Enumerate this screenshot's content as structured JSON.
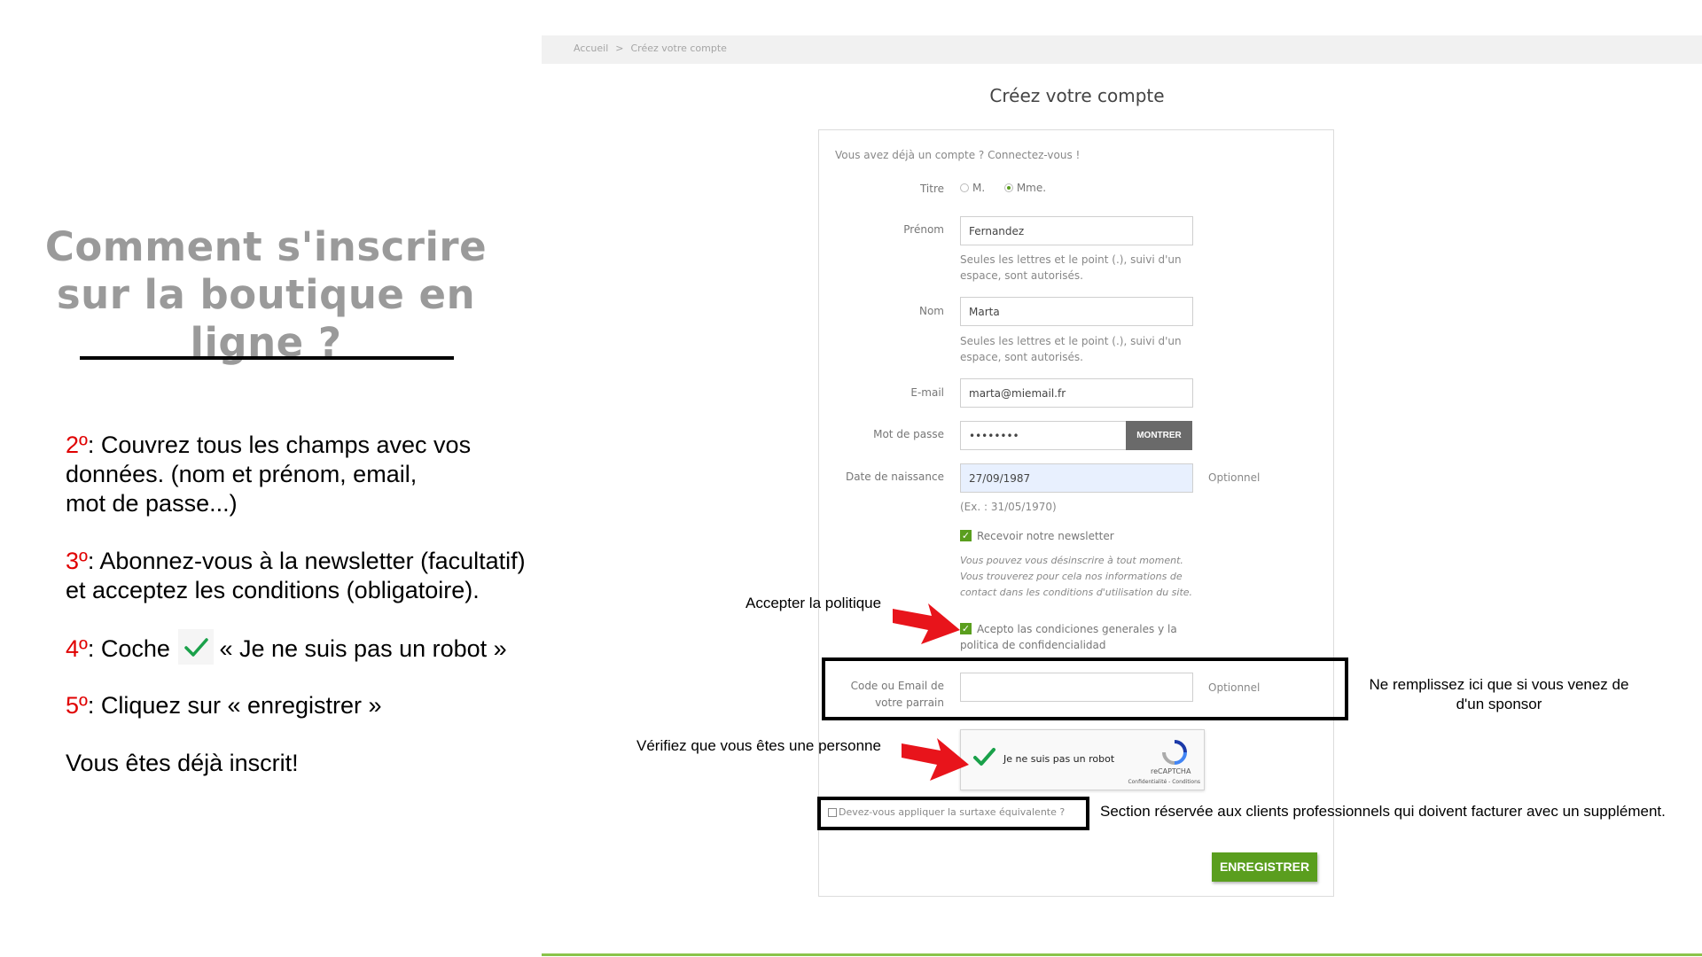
{
  "tutorial": {
    "title_line1": "Comment s'inscrire",
    "title_line2": "sur la boutique en ligne ?",
    "step2_num": "2º",
    "step2_line1": ": Couvrez tous les champs avec vos",
    "step2_line2": "données. (nom et prénom, email,",
    "step2_line3": "mot de passe...)",
    "step3_num": "3º",
    "step3_line1": ": Abonnez-vous à la newsletter (facultatif)",
    "step3_line2": "et acceptez les conditions (obligatoire).",
    "step4_num": "4º",
    "step4_pre": ": Coche",
    "step4_post": "« Je ne suis pas un robot »",
    "step5_num": "5º",
    "step5_text": ": Cliquez sur « enregistrer »",
    "done_text": "Vous êtes déjà inscrit!"
  },
  "breadcrumb": {
    "home": "Accueil",
    "separator": ">",
    "current": "Créez votre compte"
  },
  "form": {
    "page_title": "Créez votre compte",
    "login_prompt": "Vous avez déjà un compte ? Connectez-vous !",
    "title_label": "Titre",
    "title_options": [
      "M.",
      "Mme."
    ],
    "title_selected": "Mme.",
    "firstname_label": "Prénom",
    "firstname_value": "Fernandez",
    "firstname_hint_1": "Seules les lettres et le point (.), suivi d'un",
    "firstname_hint_2": "espace, sont autorisés.",
    "lastname_label": "Nom",
    "lastname_value": "Marta",
    "lastname_hint_1": "Seules les lettres et le point (.), suivi d'un",
    "lastname_hint_2": "espace, sont autorisés.",
    "email_label": "E-mail",
    "email_value": "marta@miemail.fr",
    "password_label": "Mot de passe",
    "password_value": "••••••••",
    "show_button": "MONTRER",
    "birthdate_label": "Date de naissance",
    "birthdate_value": "27/09/1987",
    "optional": "Optionnel",
    "birthdate_hint": "(Ex. : 31/05/1970)",
    "newsletter_label": "Recevoir notre newsletter",
    "newsletter_note_1": "Vous pouvez vous désinscrire à tout moment.",
    "newsletter_note_2": "Vous trouverez pour cela nos informations de",
    "newsletter_note_3": "contact dans les conditions d'utilisation du site.",
    "policy_label_1": "Acepto las condiciones generales y la",
    "policy_label_2": "politica de confidencialidad",
    "sponsor_label_1": "Code ou Email de",
    "sponsor_label_2": "votre parrain",
    "sponsor_value": "",
    "recaptcha_label": "Je ne suis pas un robot",
    "recaptcha_brand": "reCAPTCHA",
    "recaptcha_links": "Confidentialité - Conditions",
    "surcharge_label": "Devez-vous appliquer la surtaxe équivalente ?",
    "register_button": "ENREGISTRER"
  },
  "annotations": {
    "accept_policy": "Accepter la politique",
    "sponsor_note_1": "Ne remplissez ici que si vous venez de",
    "sponsor_note_2": "d'un sponsor",
    "verify_person": "Vérifiez que vous êtes une personne",
    "pro_section": "Section réservée aux clients professionnels qui doivent facturer avec un supplément."
  },
  "colors": {
    "accent_green": "#5a9e1e",
    "step_number_red": "#e00000",
    "arrow_red": "#e8141b"
  }
}
